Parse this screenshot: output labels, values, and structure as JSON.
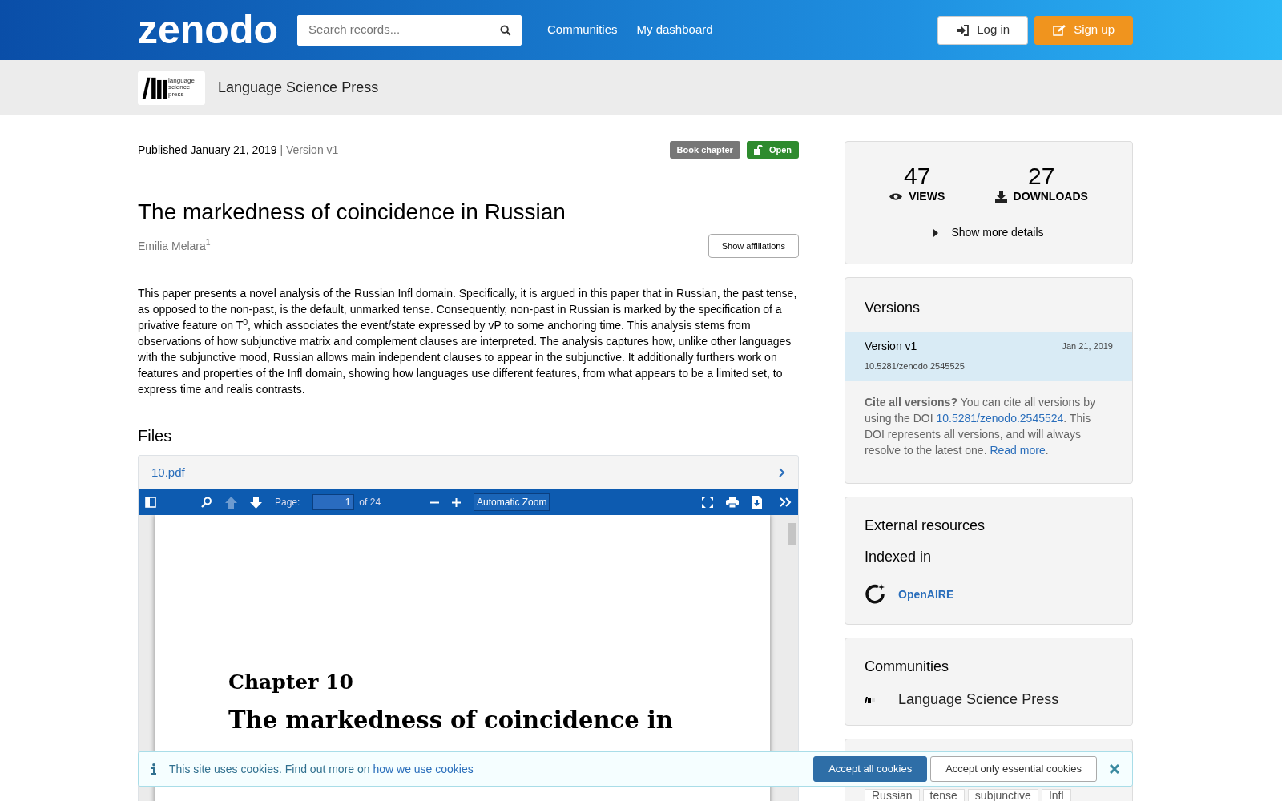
{
  "header": {
    "logo": "zenodo",
    "search": {
      "placeholder": "Search records..."
    },
    "nav": [
      "Communities",
      "My dashboard"
    ],
    "buttons": [
      {
        "kind": "login",
        "label": "Log in"
      },
      {
        "kind": "signup",
        "label": "Sign up"
      }
    ]
  },
  "community_bar": {
    "name": "Language Science Press",
    "logo_text": [
      "language",
      "science",
      "press"
    ]
  },
  "record": {
    "published": "Published January 21, 2019",
    "version": "| Version v1",
    "badges": [
      {
        "kind": "type",
        "label": "Book chapter"
      },
      {
        "kind": "access",
        "label": "Open"
      }
    ],
    "title": "The markedness of coincidence in Russian",
    "author": "Emilia Melara",
    "author_mark": "1",
    "affiliations_button": "Show affiliations",
    "abstract": "This paper presents a novel analysis of the Russian Infl domain. Specifically, it is argued in this paper that in Russian, the past tense, as opposed to the non-past, is the default, unmarked tense. Consequently, non-past in Russian is marked by the specification of a privative feature on T$^{0}$, which associates the event/state expressed by vP to some anchoring time. This analysis stems from observations of how subjunctive matrix and complement clauses are interpreted. The analysis captures how, unlike other languages with the subjunctive mood, Russian allows main independent clauses to appear in the subjunctive. It additionally furthers work on features and properties of the Infl domain, showing how languages use different features, from what appears to be a limited set, to express time and realis contrasts."
  },
  "files": {
    "heading": "Files",
    "file": "10.pdf",
    "viewer": {
      "page_label": "Page:",
      "page": "1",
      "page_count": "of 24",
      "zoom": "Automatic Zoom",
      "tools": [
        {
          "kind": "sidebar",
          "disabled": false
        },
        {
          "kind": "search",
          "disabled": false
        },
        {
          "kind": "up",
          "disabled": true
        },
        {
          "kind": "down",
          "disabled": false
        }
      ],
      "document": {
        "chapter": "Chapter 10",
        "title": "The markedness of coincidence in"
      }
    }
  },
  "stats": {
    "views": "47",
    "views_label": "VIEWS",
    "downloads": "27",
    "downloads_label": "DOWNLOADS",
    "more": "Show more details"
  },
  "versions": {
    "heading": "Versions",
    "items": [
      {
        "label": "Version v1",
        "date": "Jan 21, 2019",
        "doi": "10.5281/zenodo.2545525",
        "selected": true
      }
    ],
    "cite": "**Cite all versions?** You can cite all versions by using the DOI ",
    "cite_doi": "10.5281/zenodo.2545524",
    "cite_rest": ". This DOI represents all versions, and will always resolve to the latest one. ",
    "read_more": "Read more",
    "cite_end": "."
  },
  "external": {
    "heading": "External resources",
    "subheading": "Indexed in",
    "link": "OpenAIRE"
  },
  "communities": {
    "heading": "Communities",
    "items": [
      "Language Science Press"
    ]
  },
  "keywords": [
    "Russian",
    "tense",
    "subjunctive",
    "Infl"
  ],
  "cookie_banner": {
    "text": "This site uses cookies. Find out more on ",
    "link": "how we use cookies",
    "accept_all": "Accept all cookies",
    "accept_essential": "Accept only essential cookies"
  }
}
